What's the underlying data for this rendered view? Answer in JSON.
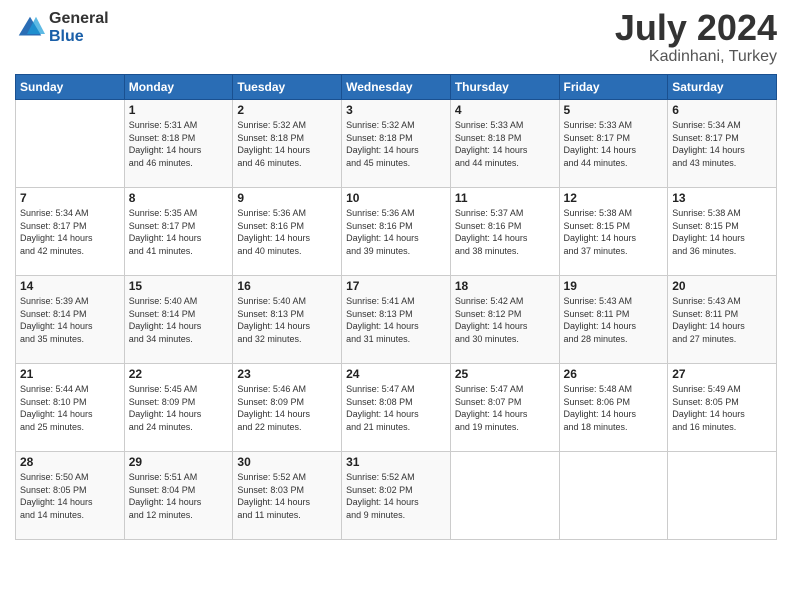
{
  "logo": {
    "general": "General",
    "blue": "Blue"
  },
  "title": {
    "month": "July 2024",
    "location": "Kadinhani, Turkey"
  },
  "weekdays": [
    "Sunday",
    "Monday",
    "Tuesday",
    "Wednesday",
    "Thursday",
    "Friday",
    "Saturday"
  ],
  "weeks": [
    [
      {
        "day": "",
        "sunrise": "",
        "sunset": "",
        "daylight": ""
      },
      {
        "day": "1",
        "sunrise": "Sunrise: 5:31 AM",
        "sunset": "Sunset: 8:18 PM",
        "daylight": "Daylight: 14 hours and 46 minutes."
      },
      {
        "day": "2",
        "sunrise": "Sunrise: 5:32 AM",
        "sunset": "Sunset: 8:18 PM",
        "daylight": "Daylight: 14 hours and 46 minutes."
      },
      {
        "day": "3",
        "sunrise": "Sunrise: 5:32 AM",
        "sunset": "Sunset: 8:18 PM",
        "daylight": "Daylight: 14 hours and 45 minutes."
      },
      {
        "day": "4",
        "sunrise": "Sunrise: 5:33 AM",
        "sunset": "Sunset: 8:18 PM",
        "daylight": "Daylight: 14 hours and 44 minutes."
      },
      {
        "day": "5",
        "sunrise": "Sunrise: 5:33 AM",
        "sunset": "Sunset: 8:17 PM",
        "daylight": "Daylight: 14 hours and 44 minutes."
      },
      {
        "day": "6",
        "sunrise": "Sunrise: 5:34 AM",
        "sunset": "Sunset: 8:17 PM",
        "daylight": "Daylight: 14 hours and 43 minutes."
      }
    ],
    [
      {
        "day": "7",
        "sunrise": "Sunrise: 5:34 AM",
        "sunset": "Sunset: 8:17 PM",
        "daylight": "Daylight: 14 hours and 42 minutes."
      },
      {
        "day": "8",
        "sunrise": "Sunrise: 5:35 AM",
        "sunset": "Sunset: 8:17 PM",
        "daylight": "Daylight: 14 hours and 41 minutes."
      },
      {
        "day": "9",
        "sunrise": "Sunrise: 5:36 AM",
        "sunset": "Sunset: 8:16 PM",
        "daylight": "Daylight: 14 hours and 40 minutes."
      },
      {
        "day": "10",
        "sunrise": "Sunrise: 5:36 AM",
        "sunset": "Sunset: 8:16 PM",
        "daylight": "Daylight: 14 hours and 39 minutes."
      },
      {
        "day": "11",
        "sunrise": "Sunrise: 5:37 AM",
        "sunset": "Sunset: 8:16 PM",
        "daylight": "Daylight: 14 hours and 38 minutes."
      },
      {
        "day": "12",
        "sunrise": "Sunrise: 5:38 AM",
        "sunset": "Sunset: 8:15 PM",
        "daylight": "Daylight: 14 hours and 37 minutes."
      },
      {
        "day": "13",
        "sunrise": "Sunrise: 5:38 AM",
        "sunset": "Sunset: 8:15 PM",
        "daylight": "Daylight: 14 hours and 36 minutes."
      }
    ],
    [
      {
        "day": "14",
        "sunrise": "Sunrise: 5:39 AM",
        "sunset": "Sunset: 8:14 PM",
        "daylight": "Daylight: 14 hours and 35 minutes."
      },
      {
        "day": "15",
        "sunrise": "Sunrise: 5:40 AM",
        "sunset": "Sunset: 8:14 PM",
        "daylight": "Daylight: 14 hours and 34 minutes."
      },
      {
        "day": "16",
        "sunrise": "Sunrise: 5:40 AM",
        "sunset": "Sunset: 8:13 PM",
        "daylight": "Daylight: 14 hours and 32 minutes."
      },
      {
        "day": "17",
        "sunrise": "Sunrise: 5:41 AM",
        "sunset": "Sunset: 8:13 PM",
        "daylight": "Daylight: 14 hours and 31 minutes."
      },
      {
        "day": "18",
        "sunrise": "Sunrise: 5:42 AM",
        "sunset": "Sunset: 8:12 PM",
        "daylight": "Daylight: 14 hours and 30 minutes."
      },
      {
        "day": "19",
        "sunrise": "Sunrise: 5:43 AM",
        "sunset": "Sunset: 8:11 PM",
        "daylight": "Daylight: 14 hours and 28 minutes."
      },
      {
        "day": "20",
        "sunrise": "Sunrise: 5:43 AM",
        "sunset": "Sunset: 8:11 PM",
        "daylight": "Daylight: 14 hours and 27 minutes."
      }
    ],
    [
      {
        "day": "21",
        "sunrise": "Sunrise: 5:44 AM",
        "sunset": "Sunset: 8:10 PM",
        "daylight": "Daylight: 14 hours and 25 minutes."
      },
      {
        "day": "22",
        "sunrise": "Sunrise: 5:45 AM",
        "sunset": "Sunset: 8:09 PM",
        "daylight": "Daylight: 14 hours and 24 minutes."
      },
      {
        "day": "23",
        "sunrise": "Sunrise: 5:46 AM",
        "sunset": "Sunset: 8:09 PM",
        "daylight": "Daylight: 14 hours and 22 minutes."
      },
      {
        "day": "24",
        "sunrise": "Sunrise: 5:47 AM",
        "sunset": "Sunset: 8:08 PM",
        "daylight": "Daylight: 14 hours and 21 minutes."
      },
      {
        "day": "25",
        "sunrise": "Sunrise: 5:47 AM",
        "sunset": "Sunset: 8:07 PM",
        "daylight": "Daylight: 14 hours and 19 minutes."
      },
      {
        "day": "26",
        "sunrise": "Sunrise: 5:48 AM",
        "sunset": "Sunset: 8:06 PM",
        "daylight": "Daylight: 14 hours and 18 minutes."
      },
      {
        "day": "27",
        "sunrise": "Sunrise: 5:49 AM",
        "sunset": "Sunset: 8:05 PM",
        "daylight": "Daylight: 14 hours and 16 minutes."
      }
    ],
    [
      {
        "day": "28",
        "sunrise": "Sunrise: 5:50 AM",
        "sunset": "Sunset: 8:05 PM",
        "daylight": "Daylight: 14 hours and 14 minutes."
      },
      {
        "day": "29",
        "sunrise": "Sunrise: 5:51 AM",
        "sunset": "Sunset: 8:04 PM",
        "daylight": "Daylight: 14 hours and 12 minutes."
      },
      {
        "day": "30",
        "sunrise": "Sunrise: 5:52 AM",
        "sunset": "Sunset: 8:03 PM",
        "daylight": "Daylight: 14 hours and 11 minutes."
      },
      {
        "day": "31",
        "sunrise": "Sunrise: 5:52 AM",
        "sunset": "Sunset: 8:02 PM",
        "daylight": "Daylight: 14 hours and 9 minutes."
      },
      {
        "day": "",
        "sunrise": "",
        "sunset": "",
        "daylight": ""
      },
      {
        "day": "",
        "sunrise": "",
        "sunset": "",
        "daylight": ""
      },
      {
        "day": "",
        "sunrise": "",
        "sunset": "",
        "daylight": ""
      }
    ]
  ]
}
